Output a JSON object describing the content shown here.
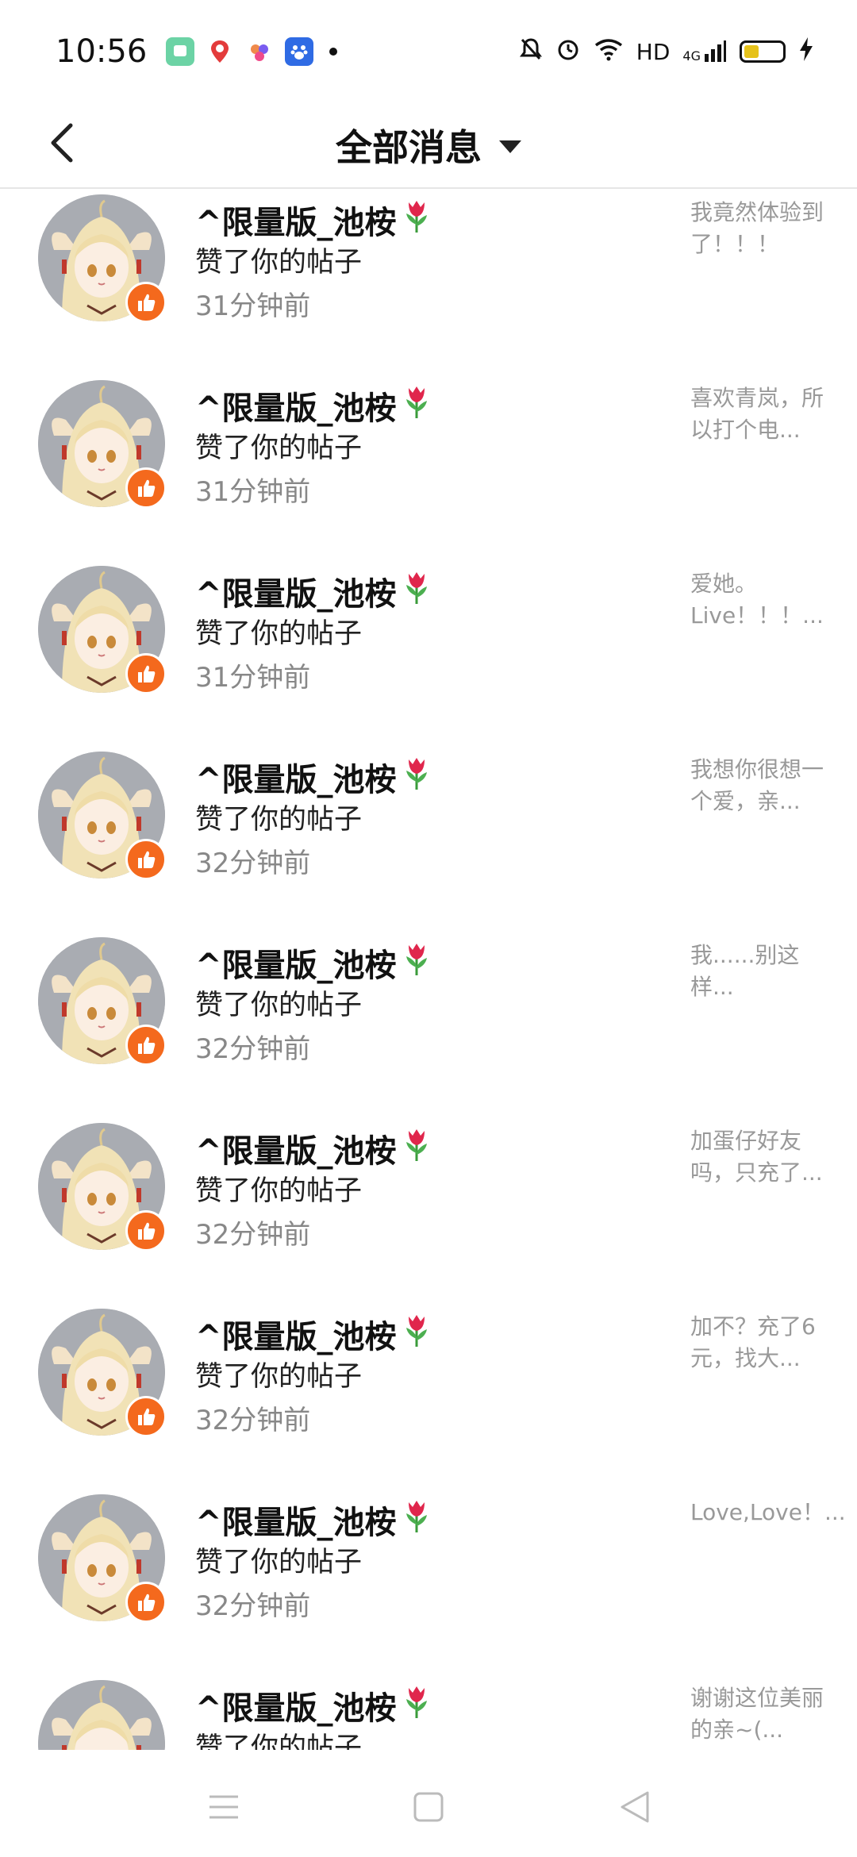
{
  "status_bar": {
    "time": "10:56",
    "apps": [
      {
        "icon": "green-chat-app-icon",
        "color": "#6cd3a5"
      },
      {
        "icon": "location-pin-app-icon",
        "color": "#ffffff"
      },
      {
        "icon": "palette-app-icon",
        "color": "#ffffff"
      },
      {
        "icon": "baidu-paw-app-icon",
        "color": "#2f6be4"
      }
    ],
    "hd": "HD",
    "network": "4G"
  },
  "header": {
    "title": "全部消息"
  },
  "notifications": [
    {
      "name": "^限量版_池桉",
      "action": "赞了你的帖子",
      "time": "31分钟前",
      "preview": "我竟然体验到了！！！"
    },
    {
      "name": "^限量版_池桉",
      "action": "赞了你的帖子",
      "time": "31分钟前",
      "preview": "喜欢青岚，所以打个电..."
    },
    {
      "name": "^限量版_池桉",
      "action": "赞了你的帖子",
      "time": "31分钟前",
      "preview": "爱她。Live！！！..."
    },
    {
      "name": "^限量版_池桉",
      "action": "赞了你的帖子",
      "time": "32分钟前",
      "preview": "我想你很想一个爱，亲..."
    },
    {
      "name": "^限量版_池桉",
      "action": "赞了你的帖子",
      "time": "32分钟前",
      "preview": "我......别这样..."
    },
    {
      "name": "^限量版_池桉",
      "action": "赞了你的帖子",
      "time": "32分钟前",
      "preview": "加蛋仔好友吗，只充了..."
    },
    {
      "name": "^限量版_池桉",
      "action": "赞了你的帖子",
      "time": "32分钟前",
      "preview": "加不？充了6元，找大..."
    },
    {
      "name": "^限量版_池桉",
      "action": "赞了你的帖子",
      "time": "32分钟前",
      "preview": "Love,Love！..."
    },
    {
      "name": "^限量版_池桉",
      "action": "赞了你的帖子",
      "time": "",
      "preview": "谢谢这位美丽的亲~(..."
    }
  ],
  "colors": {
    "like_badge": "#f4691d",
    "time_text": "#888888",
    "preview_text": "#999999"
  }
}
